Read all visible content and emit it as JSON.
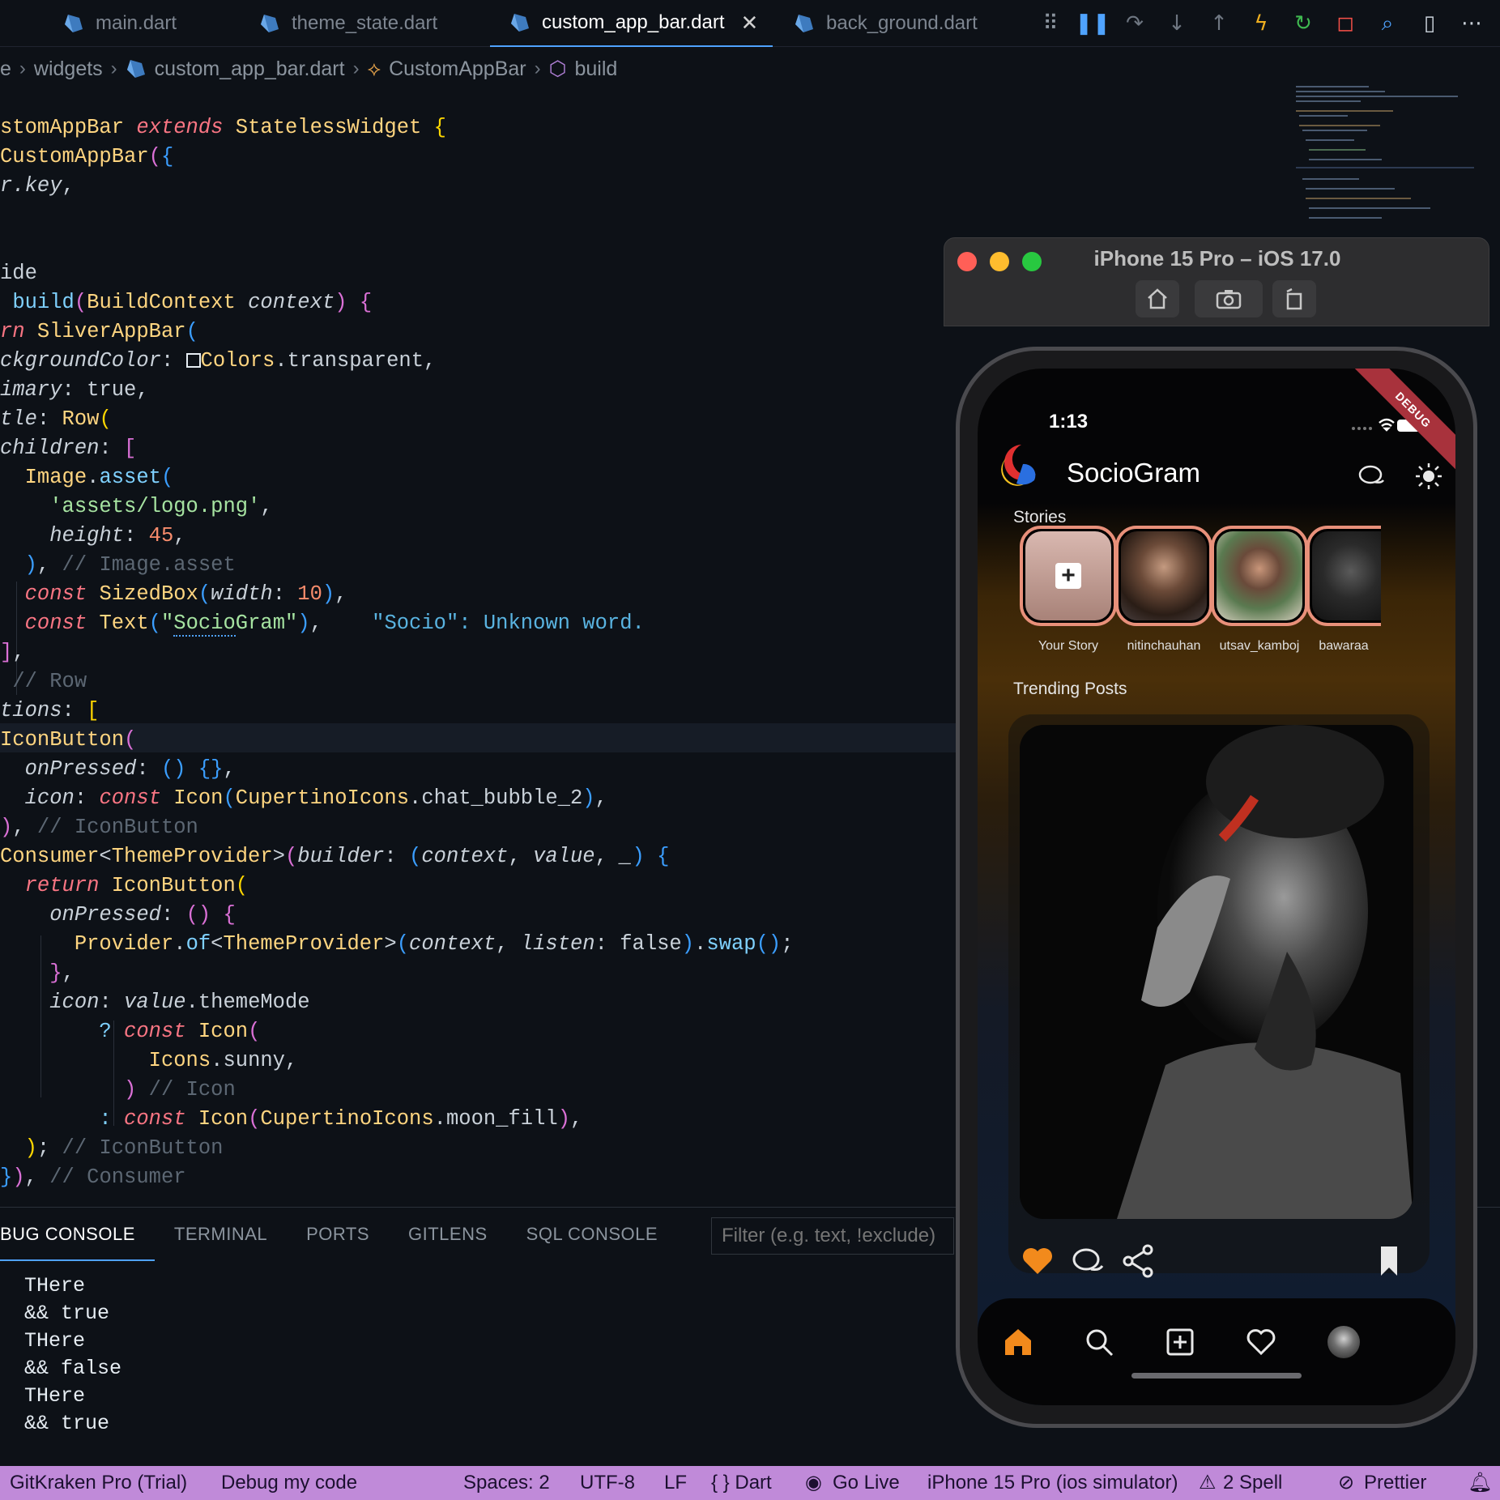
{
  "tabs": [
    {
      "label": "main.dart"
    },
    {
      "label": "theme_state.dart"
    },
    {
      "label": "custom_app_bar.dart",
      "active": true
    },
    {
      "label": "back_ground.dart"
    }
  ],
  "breadcrumb": {
    "items": [
      "e",
      "widgets",
      "custom_app_bar.dart",
      "CustomAppBar",
      "build"
    ]
  },
  "code": {
    "hint": "\"Socio\": Unknown word."
  },
  "panel": {
    "tabs": [
      "BUG CONSOLE",
      "TERMINAL",
      "PORTS",
      "GITLENS",
      "SQL CONSOLE"
    ],
    "filter_placeholder": "Filter (e.g. text, !exclude)",
    "console_lines": [
      "THere",
      "&& true",
      "THere",
      "&& false",
      "THere",
      "&& true"
    ]
  },
  "status": {
    "gitkraken": "GitKraken Pro (Trial)",
    "debug": "Debug my code",
    "spaces": "Spaces: 2",
    "encoding": "UTF-8",
    "eol": "LF",
    "language": "{ } Dart",
    "golive": "Go Live",
    "device": "iPhone 15 Pro (ios simulator)",
    "spell": "2 Spell",
    "prettier": "Prettier"
  },
  "simulator": {
    "title": "iPhone 15 Pro – iOS 17.0"
  },
  "app": {
    "time": "1:13",
    "debug_banner": "DEBUG",
    "name": "SocioGram",
    "stories_label": "Stories",
    "stories": [
      "Your Story",
      "nitinchauhan",
      "utsav_kamboj",
      "bawaraa"
    ],
    "trending_label": "Trending Posts",
    "accent": "#f28a1c"
  },
  "colors": {
    "statusbar": "#c08ad9",
    "editor_bg": "#0d1117",
    "story_ring": "#e8907a"
  }
}
